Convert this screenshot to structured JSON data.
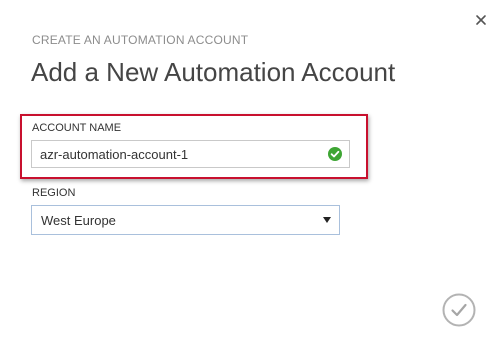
{
  "dialog": {
    "subtitle": "CREATE AN AUTOMATION ACCOUNT",
    "title": "Add a New Automation Account",
    "close_icon": "close-icon",
    "confirm_icon": "checkmark-circle-icon"
  },
  "form": {
    "account_name": {
      "label": "ACCOUNT NAME",
      "value": "azr-automation-account-1",
      "status_icon": "valid-check-icon",
      "status_color": "#3ea534"
    },
    "region": {
      "label": "REGION",
      "selected": "West Europe",
      "arrow_icon": "dropdown-arrow-icon"
    }
  },
  "colors": {
    "highlight_border": "#c8102e",
    "select_border": "#a9c0dc",
    "confirm_icon": "#b3b3b3"
  }
}
